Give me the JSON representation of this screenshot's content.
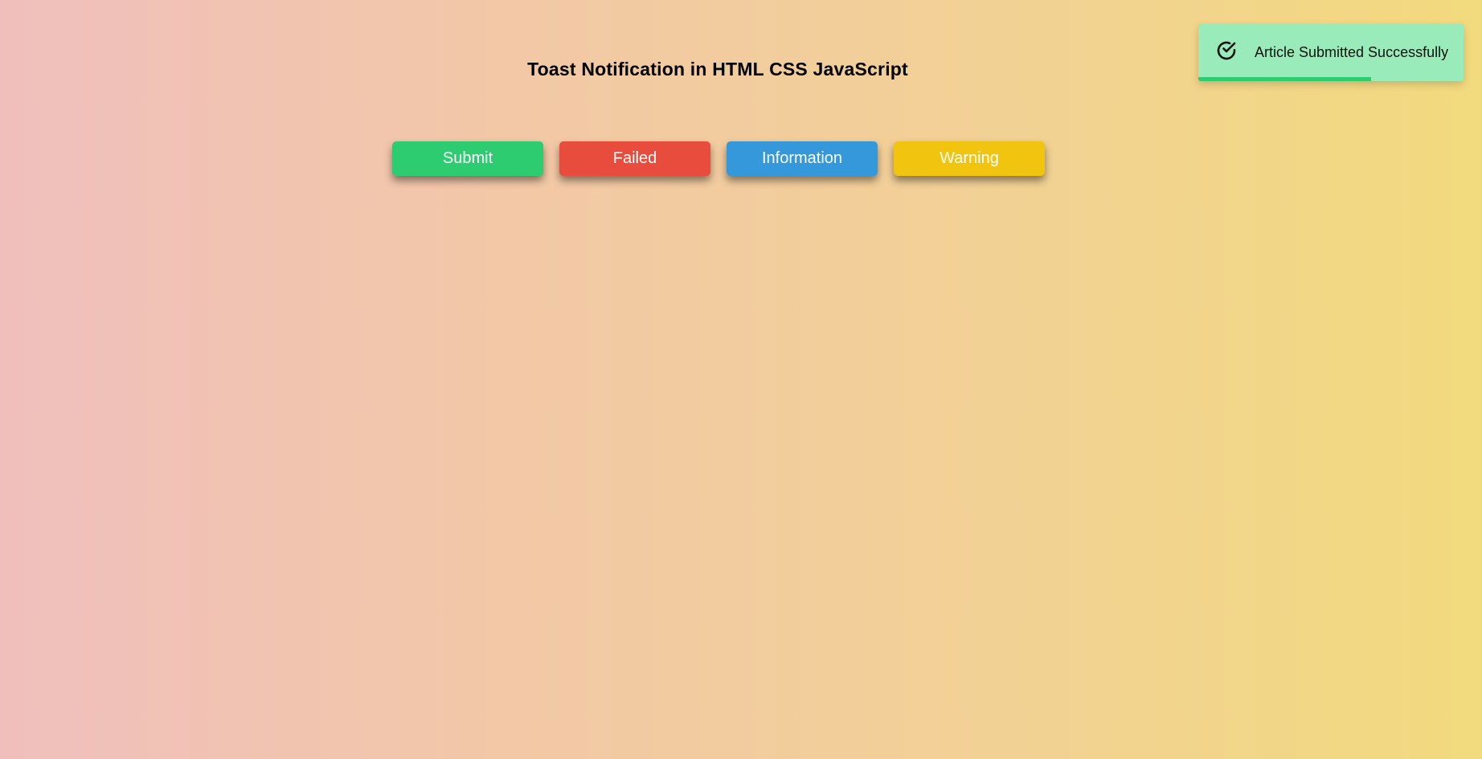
{
  "page": {
    "title": "Toast Notification in HTML CSS JavaScript"
  },
  "buttons": [
    {
      "label": "Submit",
      "color": "#2ecc71"
    },
    {
      "label": "Failed",
      "color": "#e74c3c"
    },
    {
      "label": "Information",
      "color": "#3498db"
    },
    {
      "label": "Warning",
      "color": "#f1c40f"
    }
  ],
  "toast": {
    "message": "Article Submitted Successfully",
    "icon": "check-circle-icon",
    "background": "#99ebb9",
    "progress_color": "#2ecc71",
    "progress_fraction": 0.65
  }
}
